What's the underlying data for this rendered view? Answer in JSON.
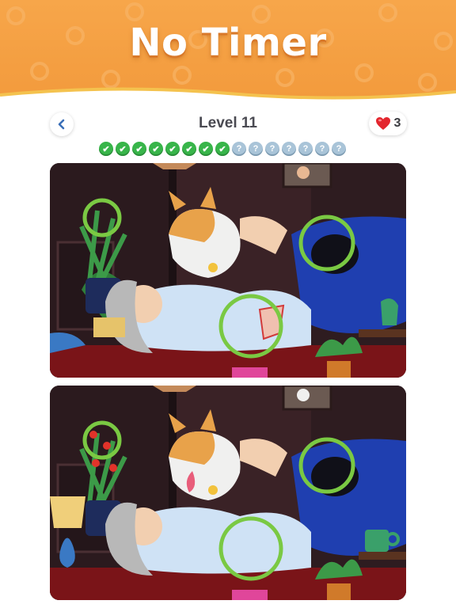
{
  "banner": {
    "title": "No Timer"
  },
  "header": {
    "back_icon": "chevron-left-icon",
    "level_title": "Level 11",
    "lives_icon": "heart-icon",
    "lives_count": "3"
  },
  "progress": {
    "found": 8,
    "total": 15,
    "pending_glyph": "?",
    "found_glyph": "✔"
  },
  "scenes": [
    {
      "name": "top",
      "found_differences": 3
    },
    {
      "name": "bottom",
      "found_differences": 3
    }
  ],
  "colors": {
    "banner": "#f29a3c",
    "found": "#38b54a",
    "pending": "#a9c4d8",
    "marker": "#7ac943",
    "heart": "#e3262e"
  }
}
